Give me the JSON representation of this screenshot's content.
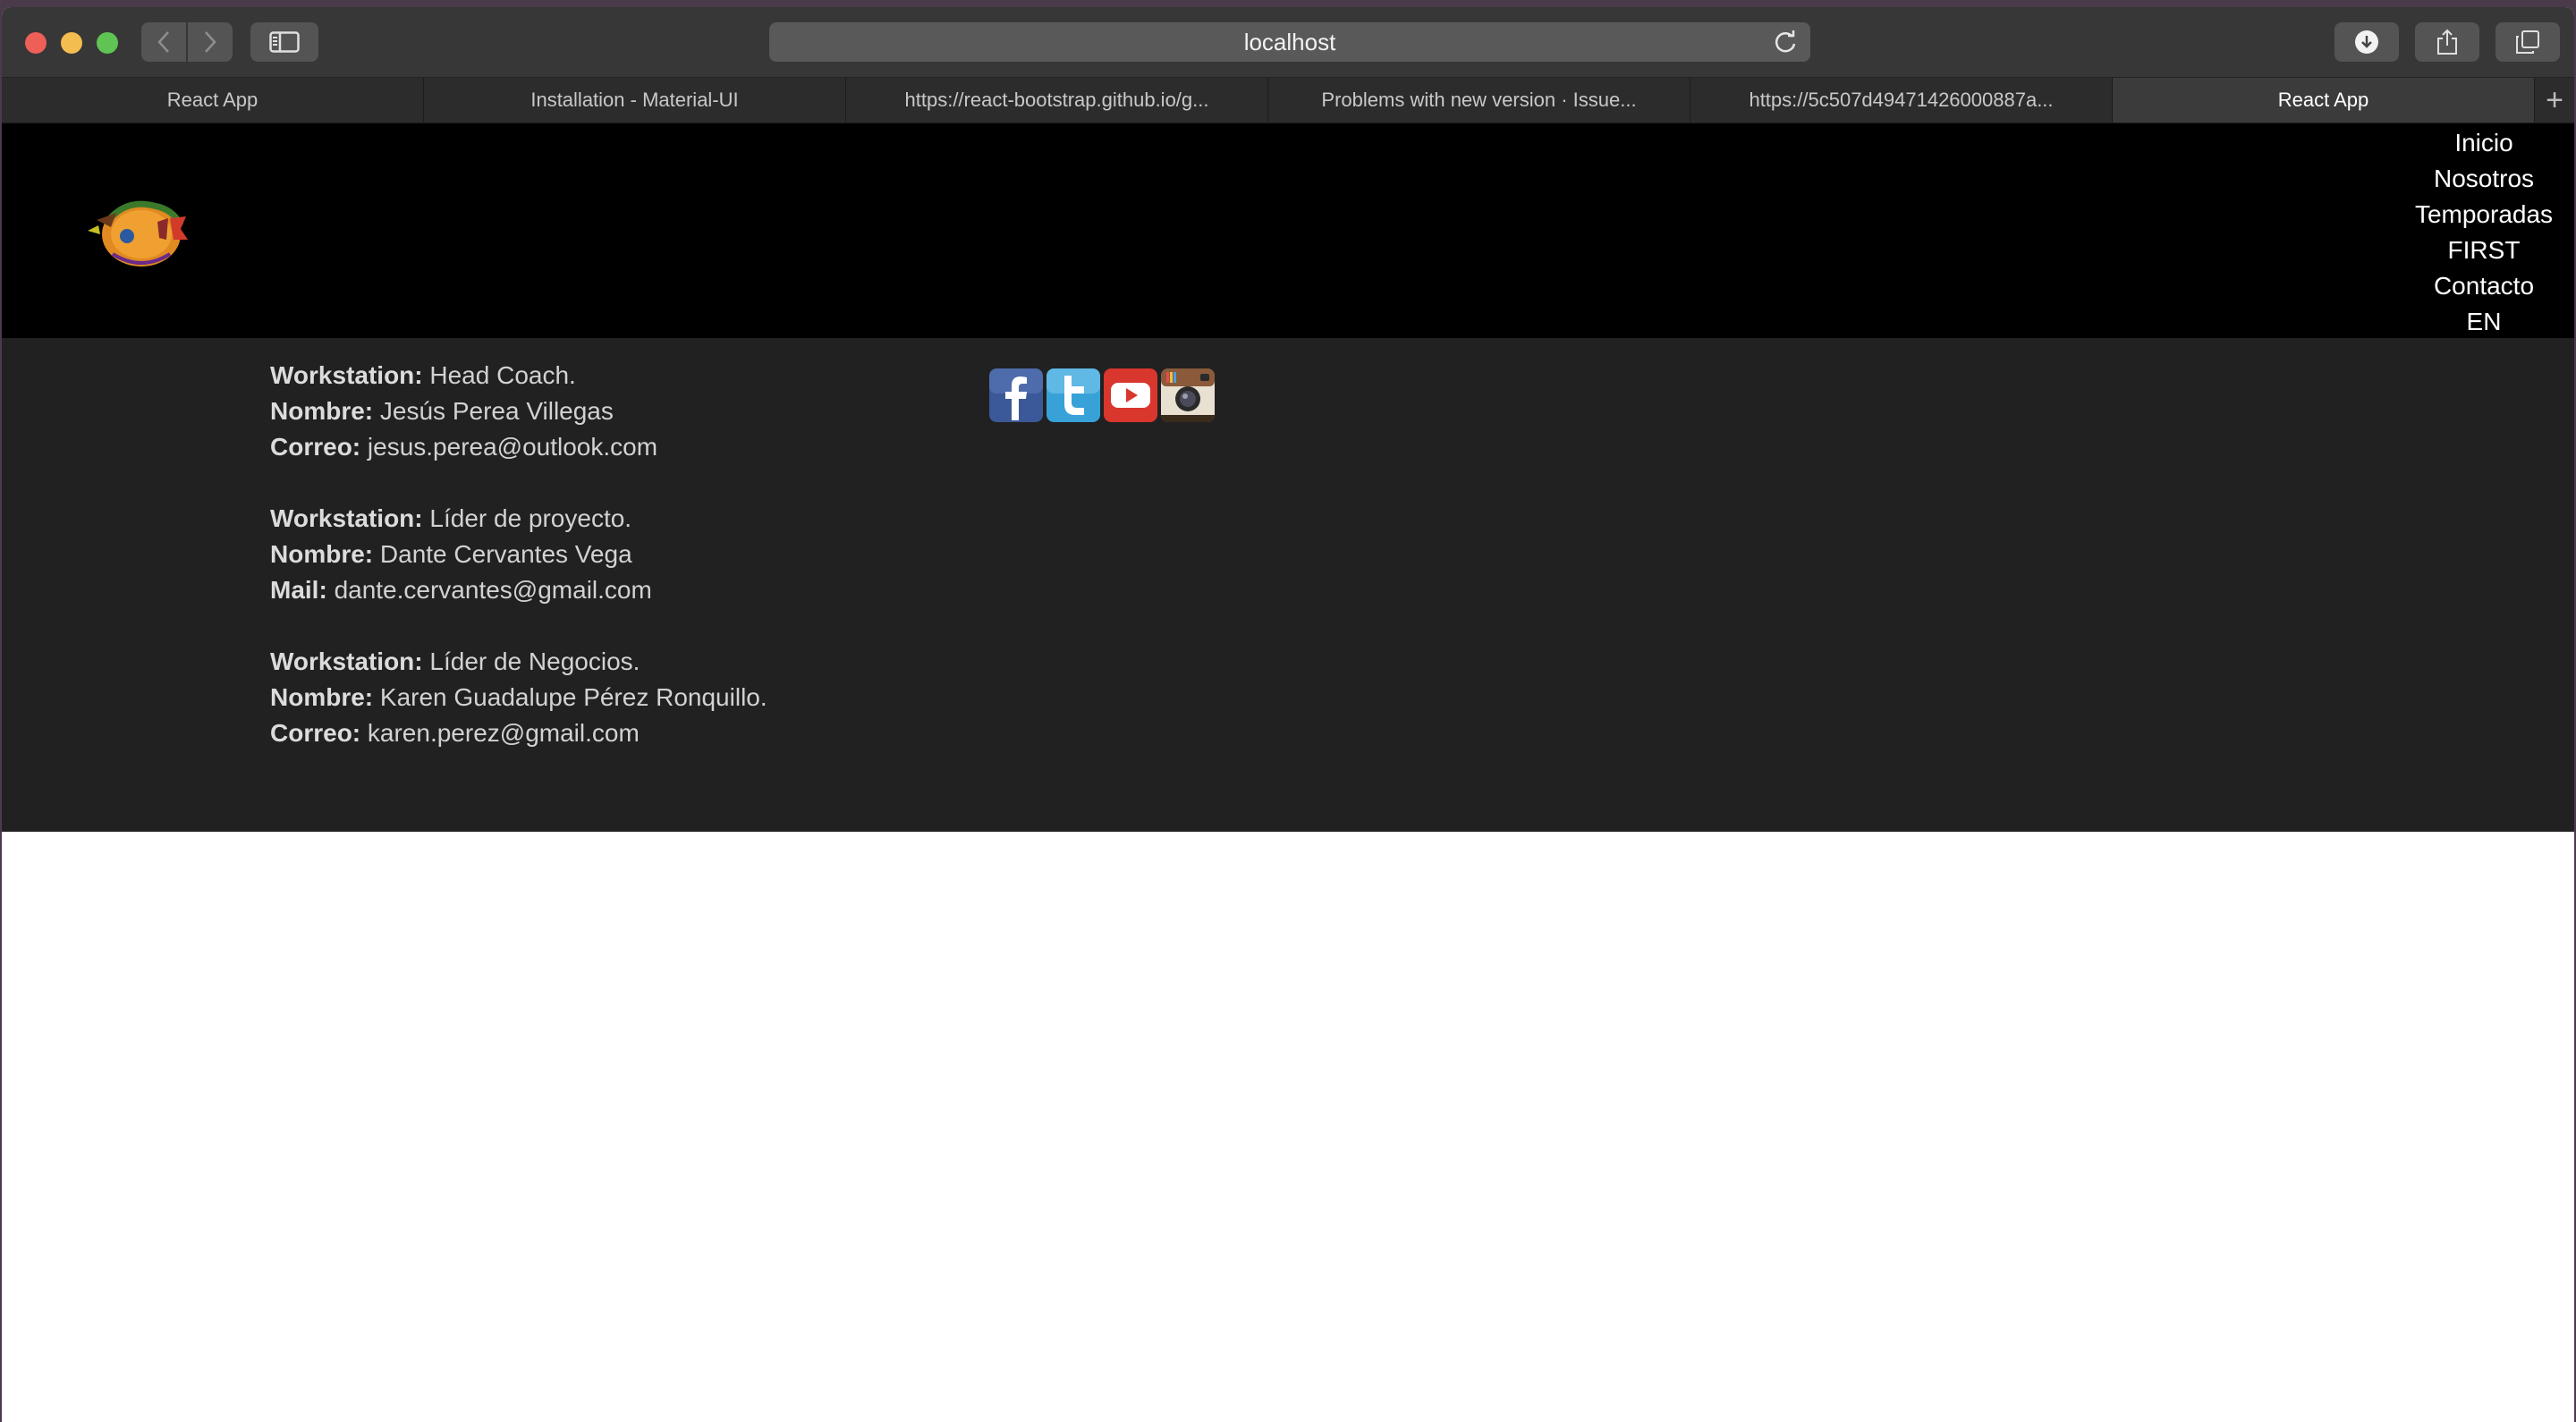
{
  "browser": {
    "address": "localhost",
    "tabs": [
      {
        "label": "React App",
        "active": false
      },
      {
        "label": "Installation - Material-UI",
        "active": false
      },
      {
        "label": "https://react-bootstrap.github.io/g...",
        "active": false
      },
      {
        "label": "Problems with new version · Issue...",
        "active": false
      },
      {
        "label": "https://5c507d49471426000887a...",
        "active": false
      },
      {
        "label": "React App",
        "active": true
      }
    ],
    "new_tab": "+"
  },
  "nav": {
    "items": [
      "Inicio",
      "Nosotros",
      "Temporadas",
      "FIRST",
      "Contacto",
      "EN"
    ]
  },
  "contacts": [
    {
      "lines": [
        {
          "label": "Workstation:",
          "value": "Head Coach."
        },
        {
          "label": "Nombre:",
          "value": "Jesús Perea Villegas"
        },
        {
          "label": "Correo:",
          "value": "jesus.perea@outlook.com"
        }
      ]
    },
    {
      "lines": [
        {
          "label": "Workstation:",
          "value": "Líder de proyecto."
        },
        {
          "label": "Nombre:",
          "value": "Dante Cervantes Vega"
        },
        {
          "label": "Mail:",
          "value": "dante.cervantes@gmail.com"
        }
      ]
    },
    {
      "lines": [
        {
          "label": "Workstation:",
          "value": "Líder de Negocios."
        },
        {
          "label": "Nombre:",
          "value": "Karen Guadalupe Pérez Ronquillo."
        },
        {
          "label": "Correo:",
          "value": "karen.perez@gmail.com"
        }
      ]
    }
  ],
  "social": [
    "facebook-icon",
    "twitter-icon",
    "youtube-icon",
    "instagram-icon"
  ],
  "colors": {
    "header_bg": "#000000",
    "content_bg": "#212121",
    "facebook": "#3b5998",
    "twitter": "#38a1d8",
    "youtube": "#d9362e"
  }
}
